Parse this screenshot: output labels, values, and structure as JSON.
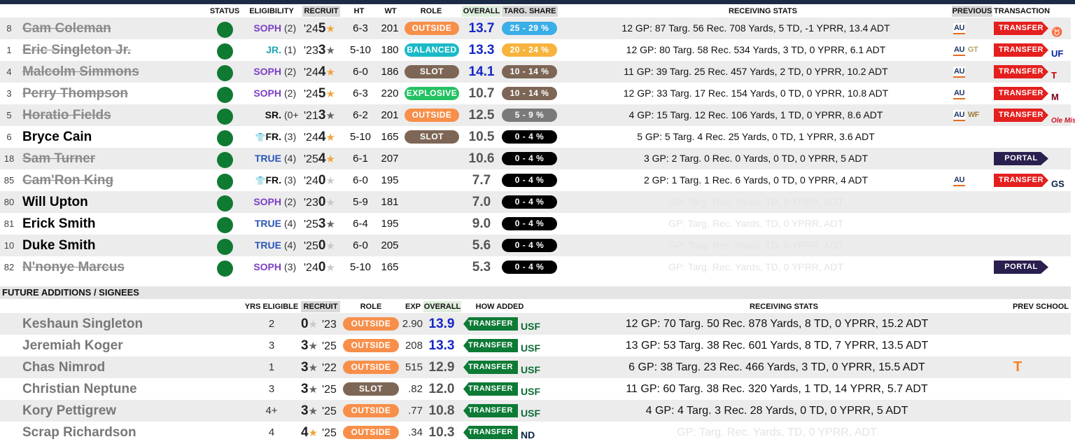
{
  "colors": {
    "outside": "#f78f4a",
    "balanced": "#1bb9c7",
    "slot": "#7d6656",
    "explosive": "#23c162",
    "share_blue": "#3aaee6",
    "share_orange": "#f7b33d",
    "share_brown": "#7d6656",
    "share_gray": "#7a7a7a",
    "share_black": "#000000"
  },
  "roster_headers": {
    "status": "STATUS",
    "eligibility": "ELIGIBILITY",
    "recruit": "RECRUIT",
    "ht": "HT",
    "wt": "WT",
    "role": "ROLE",
    "overall": "OVERALL",
    "targ_share": "TARG. SHARE",
    "receiving_stats": "RECEIVING STATS",
    "previous": "PREVIOUS",
    "transaction": "TRANSACTION"
  },
  "players": [
    {
      "num": "8",
      "name": "Cam Coleman",
      "elig": "SOPH",
      "yrs": "(2)",
      "rec_year": "'24",
      "rec_stars": "5",
      "ht": "6-3",
      "wt": "201",
      "role": "OUTSIDE",
      "overall": "13.7",
      "share": "25 - 29 %",
      "stats": "12 GP: 87 Targ. 56 Rec. 708 Yards, 5 TD, -1 YPRR, 13.4 ADT",
      "prev": [
        "AU"
      ],
      "transaction": "TRANSFER",
      "dest": "longhorn-logo"
    },
    {
      "num": "1",
      "name": "Eric Singleton Jr.",
      "elig": "JR.",
      "yrs": "(1)",
      "rec_year": "'23",
      "rec_stars": "3",
      "ht": "5-10",
      "wt": "180",
      "role": "BALANCED",
      "overall": "13.3",
      "share": "20 - 24 %",
      "stats": "12 GP: 80 Targ. 58 Rec. 534 Yards, 3 TD, 0 YPRR, 6.1 ADT",
      "prev": [
        "AU",
        "GT"
      ],
      "transaction": "TRANSFER",
      "dest": "gator-logo"
    },
    {
      "num": "4",
      "name": "Malcolm Simmons",
      "elig": "SOPH",
      "yrs": "(2)",
      "rec_year": "'24",
      "rec_stars": "4",
      "ht": "6-0",
      "wt": "186",
      "role": "SLOT",
      "overall": "14.1",
      "share": "10 - 14 %",
      "stats": "11 GP: 39 Targ. 25 Rec. 457 Yards, 2 TD, 0 YPRR, 10.2 ADT",
      "prev": [
        "AU"
      ],
      "transaction": "TRANSFER",
      "dest": "tt-logo"
    },
    {
      "num": "3",
      "name": "Perry Thompson",
      "elig": "SOPH",
      "yrs": "(2)",
      "rec_year": "'24",
      "rec_stars": "5",
      "ht": "6-3",
      "wt": "220",
      "role": "EXPLOSIVE",
      "overall": "10.7",
      "share": "10 - 14 %",
      "stats": "12 GP: 33 Targ. 17 Rec. 154 Yards, 0 TD, 0 YPRR, 10.8 ADT",
      "prev": [
        "AU"
      ],
      "transaction": "TRANSFER",
      "dest": "m-logo"
    },
    {
      "num": "5",
      "name": "Horatio Fields",
      "elig": "SR.",
      "yrs": "(0+",
      "rec_year": "'21",
      "rec_stars": "3",
      "ht": "6-2",
      "wt": "201",
      "role": "OUTSIDE",
      "overall": "12.5",
      "share": "5 - 9 %",
      "stats": "4 GP: 15 Targ. 12 Rec. 106 Yards, 1 TD, 0 YPRR, 8.6 ADT",
      "prev": [
        "AU",
        "WF"
      ],
      "transaction": "TRANSFER",
      "dest": "olemiss-logo"
    },
    {
      "num": "6",
      "name": "Bryce Cain",
      "elig": "FR.",
      "yrs": "(3)",
      "rec_year": "'24",
      "rec_stars": "4",
      "ht": "5-10",
      "wt": "165",
      "role": "SLOT",
      "overall": "10.5",
      "share": "0 - 4 %",
      "stats": "5 GP: 5 Targ. 4 Rec. 25 Yards, 0 TD, 1 YPRR, 3.6 ADT",
      "prev": [],
      "transaction": "",
      "dest": ""
    },
    {
      "num": "18",
      "name": "Sam Turner",
      "elig": "TRUE",
      "yrs": "(4)",
      "rec_year": "'25",
      "rec_stars": "4",
      "ht": "6-1",
      "wt": "207",
      "role": "",
      "overall": "10.6",
      "share": "0 - 4 %",
      "stats": "3 GP: 2 Targ. 0 Rec. 0 Yards, 0 TD, 0 YPRR, 5 ADT",
      "prev": [],
      "transaction": "PORTAL",
      "dest": ""
    },
    {
      "num": "85",
      "name": "Cam'Ron King",
      "elig": "FR.",
      "yrs": "(3)",
      "rec_year": "'24",
      "rec_stars": "0",
      "ht": "6-0",
      "wt": "195",
      "role": "",
      "overall": "7.7",
      "share": "0 - 4 %",
      "stats": "2 GP: 1 Targ. 1 Rec. 6 Yards, 0 TD, 0 YPRR, 4 ADT",
      "prev": [
        "AU"
      ],
      "transaction": "TRANSFER",
      "dest": "eagle-logo"
    },
    {
      "num": "80",
      "name": "Will Upton",
      "elig": "SOPH",
      "yrs": "(2)",
      "rec_year": "'23",
      "rec_stars": "0",
      "ht": "5-9",
      "wt": "181",
      "role": "",
      "overall": "7.0",
      "share": "0 - 4 %",
      "stats": "GP: Targ. Rec. Yards, TD, 0 YPRR, ADT",
      "prev": [],
      "transaction": "",
      "dest": ""
    },
    {
      "num": "81",
      "name": "Erick Smith",
      "elig": "TRUE",
      "yrs": "(4)",
      "rec_year": "'25",
      "rec_stars": "3",
      "ht": "6-4",
      "wt": "195",
      "role": "",
      "overall": "9.0",
      "share": "0 - 4 %",
      "stats": "GP: Targ. Rec. Yards, TD, 0 YPRR, ADT",
      "prev": [],
      "transaction": "",
      "dest": ""
    },
    {
      "num": "10",
      "name": "Duke Smith",
      "elig": "TRUE",
      "yrs": "(4)",
      "rec_year": "'25",
      "rec_stars": "0",
      "ht": "6-0",
      "wt": "205",
      "role": "",
      "overall": "5.6",
      "share": "0 - 4 %",
      "stats": "GP: Targ. Rec. Yards, TD, 0 YPRR, ADT",
      "prev": [],
      "transaction": "",
      "dest": ""
    },
    {
      "num": "82",
      "name": "N'nonye Marcus",
      "elig": "SOPH",
      "yrs": "(3)",
      "rec_year": "'24",
      "rec_stars": "0",
      "ht": "5-10",
      "wt": "165",
      "role": "",
      "overall": "5.3",
      "share": "0 - 4 %",
      "stats": "GP: Targ. Rec. Yards, TD, 0 YPRR, ADT",
      "prev": [],
      "transaction": "PORTAL",
      "dest": ""
    }
  ],
  "future_section_title": "FUTURE ADDITIONS / SIGNEES",
  "future_headers": {
    "yrs_eligible": "YRS ELIGIBLE",
    "recruit": "RECRUIT",
    "role": "ROLE",
    "exp": "EXP",
    "overall": "OVERALL",
    "how_added": "HOW ADDED",
    "receiving_stats": "RECEIVING STATS",
    "prev_school": "PREV SCHOOL"
  },
  "future": [
    {
      "name": "Keshaun Singleton",
      "yrs": "2",
      "rec_stars": "0",
      "rec_year": "'23",
      "role": "OUTSIDE",
      "exp": "2.90",
      "overall": "13.9",
      "how": "TRANSFER",
      "from": "USF",
      "stats": "12 GP: 70 Targ. 50 Rec. 878 Yards, 8 TD, 0 YPRR, 15.2 ADT",
      "prev_school": ""
    },
    {
      "name": "Jeremiah Koger",
      "yrs": "3",
      "rec_stars": "3",
      "rec_year": "'25",
      "role": "OUTSIDE",
      "exp": "208",
      "overall": "13.3",
      "how": "TRANSFER",
      "from": "USF",
      "stats": "13 GP: 53 Targ. 38 Rec. 601 Yards, 8 TD, 7 YPRR, 13.5 ADT",
      "prev_school": ""
    },
    {
      "name": "Chas Nimrod",
      "yrs": "1",
      "rec_stars": "3",
      "rec_year": "'22",
      "role": "OUTSIDE",
      "exp": "515",
      "overall": "12.9",
      "how": "TRANSFER",
      "from": "USF",
      "stats": "6 GP: 38 Targ. 23 Rec. 466 Yards, 3 TD, 0 YPRR, 15.5 ADT",
      "prev_school": "T"
    },
    {
      "name": "Christian Neptune",
      "yrs": "3",
      "rec_stars": "3",
      "rec_year": "'25",
      "role": "SLOT",
      "exp": ".82",
      "overall": "12.0",
      "how": "TRANSFER",
      "from": "USF",
      "stats": "11 GP: 60 Targ. 38 Rec. 320 Yards, 1 TD, 14 YPRR, 5.7 ADT",
      "prev_school": ""
    },
    {
      "name": "Kory Pettigrew",
      "yrs": "4+",
      "rec_stars": "3",
      "rec_year": "'25",
      "role": "OUTSIDE",
      "exp": ".77",
      "overall": "10.8",
      "how": "TRANSFER",
      "from": "USF",
      "stats": "4 GP: 4 Targ. 3 Rec. 28 Yards, 0 TD, 0 YPRR, 5 ADT",
      "prev_school": ""
    },
    {
      "name": "Scrap Richardson",
      "yrs": "4",
      "rec_stars": "4",
      "rec_year": "'25",
      "role": "OUTSIDE",
      "exp": ".34",
      "overall": "10.3",
      "how": "TRANSFER",
      "from": "ND",
      "stats": "GP: Targ. Rec. Yards, TD, 0 YPRR, ADT",
      "prev_school": ""
    }
  ]
}
